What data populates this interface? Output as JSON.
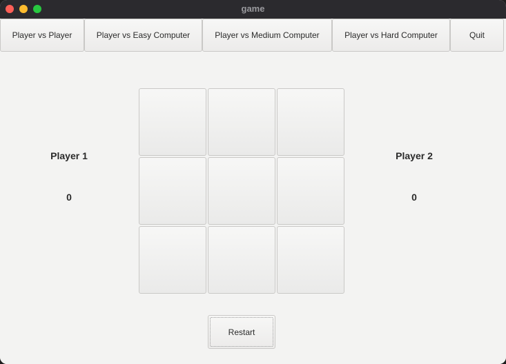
{
  "window": {
    "title": "game"
  },
  "toolbar": {
    "buttons": [
      {
        "label": "Player vs Player"
      },
      {
        "label": "Player vs Easy Computer"
      },
      {
        "label": "Player vs Medium Computer"
      },
      {
        "label": "Player vs Hard Computer"
      },
      {
        "label": "Quit"
      }
    ]
  },
  "scoreboard": {
    "player1": {
      "label": "Player 1",
      "score": "0"
    },
    "player2": {
      "label": "Player 2",
      "score": "0"
    }
  },
  "board": {
    "cells": [
      "",
      "",
      "",
      "",
      "",
      "",
      "",
      "",
      ""
    ]
  },
  "restart_label": "Restart",
  "colors": {
    "window_background": "#f3f3f2",
    "titlebar": "#2b2a2e",
    "close": "#fe5f57",
    "minimize": "#febc2e",
    "maximize": "#28c840"
  }
}
